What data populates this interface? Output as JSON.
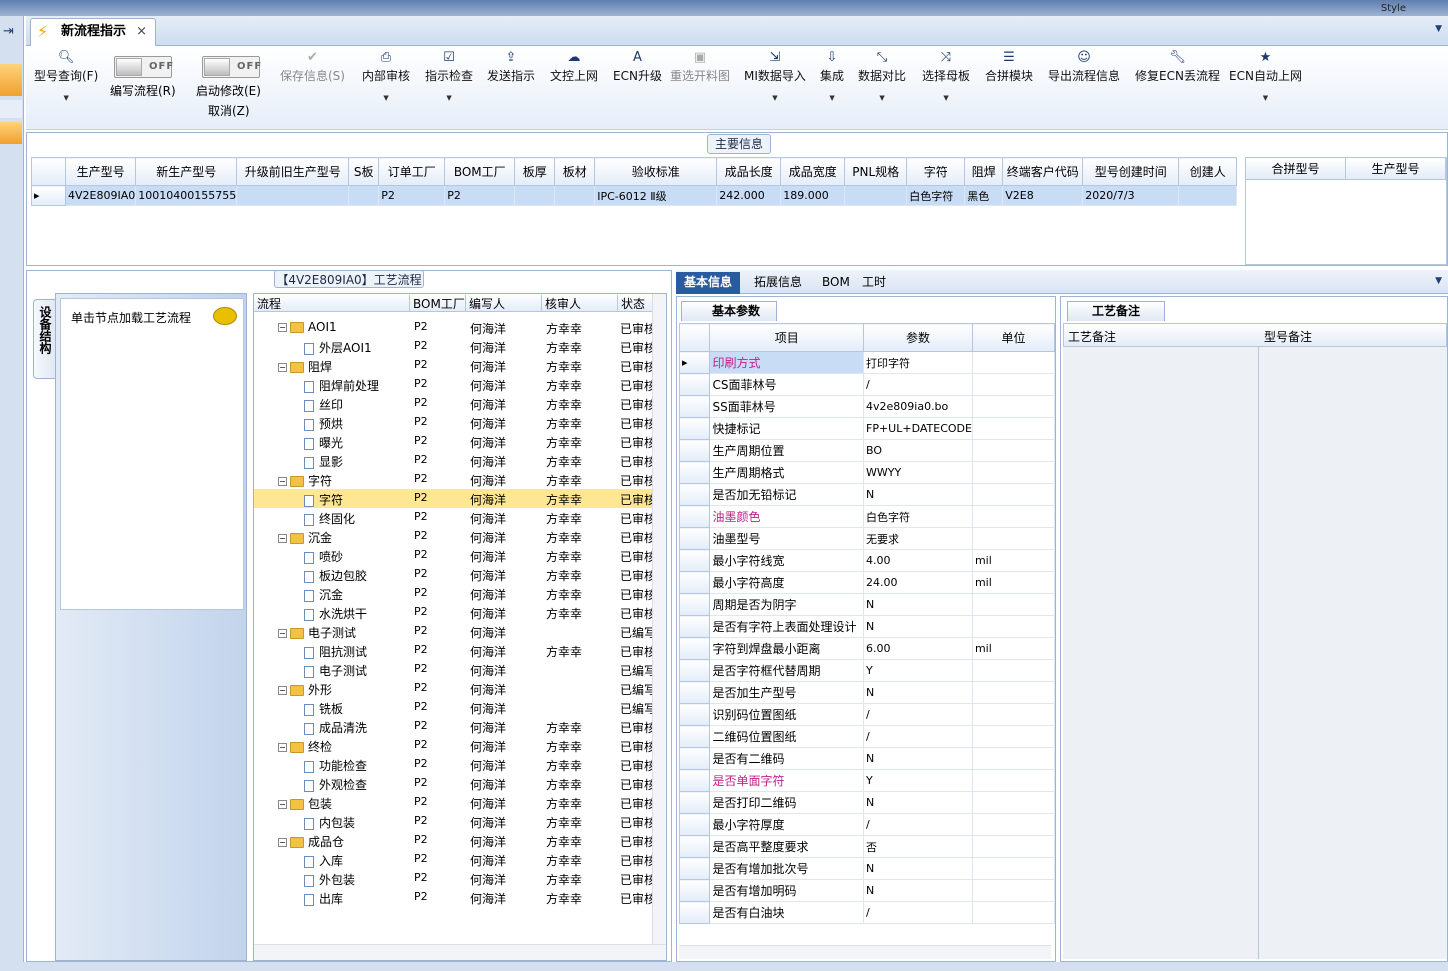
{
  "window": {
    "style_label": "Style"
  },
  "doc_tab": {
    "title": "新流程指示"
  },
  "toolbar": {
    "items": [
      {
        "label": "型号查询(F)",
        "icon": "search-icon"
      },
      {
        "label": "保存信息(S)",
        "icon": "check-icon"
      },
      {
        "label": "内部审核",
        "icon": "printer-icon"
      },
      {
        "label": "指示检查",
        "icon": "checkbox-icon"
      },
      {
        "label": "发送指示",
        "icon": "upload-icon"
      },
      {
        "label": "文控上网",
        "icon": "cloud-upload-icon"
      },
      {
        "label": "ECN升级",
        "icon": "font-icon"
      },
      {
        "label": "重选开料图",
        "icon": "image-icon"
      },
      {
        "label": "MI数据导入",
        "icon": "import-icon"
      },
      {
        "label": "集成",
        "icon": "download-icon"
      },
      {
        "label": "数据对比",
        "icon": "compress-icon"
      },
      {
        "label": "选择母板",
        "icon": "shuffle-icon"
      },
      {
        "label": "合拼模块",
        "icon": "list-icon"
      },
      {
        "label": "导出流程信息",
        "icon": "smile-icon"
      },
      {
        "label": "修复ECN丢流程",
        "icon": "wrench-icon"
      },
      {
        "label": "ECN自动上网",
        "icon": "star-icon"
      }
    ],
    "toggle_off": "OFF",
    "toggle1_label": "编写流程(R)",
    "toggle2_label": "启动修改(E)",
    "cancel_label": "取消(Z)"
  },
  "main_info": {
    "title": "主要信息",
    "columns": [
      "生产型号",
      "新生产型号",
      "升级前旧生产型号",
      "S板",
      "订单工厂",
      "BOM工厂",
      "板厚",
      "板材",
      "验收标准",
      "成品长度",
      "成品宽度",
      "PNL规格",
      "字符",
      "阻焊",
      "终端客户代码",
      "型号创建时间",
      "创建人"
    ],
    "row": [
      "4V2E809IA0",
      "10010400155755",
      "",
      "",
      "P2",
      "P2",
      "",
      "",
      "IPC-6012 Ⅱ级",
      "242.000",
      "189.000",
      "",
      "白色字符",
      "黑色",
      "V2E8",
      "2020/7/3",
      ""
    ],
    "side_columns": [
      "合拼型号",
      "生产型号"
    ]
  },
  "process": {
    "title": "【4V2E809IA0】工艺流程",
    "vtab": "设备结构",
    "load_hint": "单击节点加载工艺流程",
    "columns": [
      "流程",
      "BOM工厂",
      "编写人",
      "核审人",
      "状态"
    ],
    "rows": [
      {
        "lvl": 1,
        "name": "AOI1",
        "bom": "P2",
        "writer": "何海洋",
        "reviewer": "方幸幸",
        "status": "已审核"
      },
      {
        "lvl": 2,
        "name": "外层AOI1",
        "bom": "P2",
        "writer": "何海洋",
        "reviewer": "方幸幸",
        "status": "已审核"
      },
      {
        "lvl": 1,
        "name": "阻焊",
        "bom": "P2",
        "writer": "何海洋",
        "reviewer": "方幸幸",
        "status": "已审核"
      },
      {
        "lvl": 2,
        "name": "阻焊前处理",
        "bom": "P2",
        "writer": "何海洋",
        "reviewer": "方幸幸",
        "status": "已审核"
      },
      {
        "lvl": 2,
        "name": "丝印",
        "bom": "P2",
        "writer": "何海洋",
        "reviewer": "方幸幸",
        "status": "已审核"
      },
      {
        "lvl": 2,
        "name": "预烘",
        "bom": "P2",
        "writer": "何海洋",
        "reviewer": "方幸幸",
        "status": "已审核"
      },
      {
        "lvl": 2,
        "name": "曝光",
        "bom": "P2",
        "writer": "何海洋",
        "reviewer": "方幸幸",
        "status": "已审核"
      },
      {
        "lvl": 2,
        "name": "显影",
        "bom": "P2",
        "writer": "何海洋",
        "reviewer": "方幸幸",
        "status": "已审核"
      },
      {
        "lvl": 1,
        "name": "字符",
        "bom": "P2",
        "writer": "何海洋",
        "reviewer": "方幸幸",
        "status": "已审核"
      },
      {
        "lvl": 2,
        "name": "字符",
        "bom": "P2",
        "writer": "何海洋",
        "reviewer": "方幸幸",
        "status": "已审核",
        "hl": true
      },
      {
        "lvl": 2,
        "name": "终固化",
        "bom": "P2",
        "writer": "何海洋",
        "reviewer": "方幸幸",
        "status": "已审核"
      },
      {
        "lvl": 1,
        "name": "沉金",
        "bom": "P2",
        "writer": "何海洋",
        "reviewer": "方幸幸",
        "status": "已审核"
      },
      {
        "lvl": 2,
        "name": "喷砂",
        "bom": "P2",
        "writer": "何海洋",
        "reviewer": "方幸幸",
        "status": "已审核"
      },
      {
        "lvl": 2,
        "name": "板边包胶",
        "bom": "P2",
        "writer": "何海洋",
        "reviewer": "方幸幸",
        "status": "已审核"
      },
      {
        "lvl": 2,
        "name": "沉金",
        "bom": "P2",
        "writer": "何海洋",
        "reviewer": "方幸幸",
        "status": "已审核"
      },
      {
        "lvl": 2,
        "name": "水洗烘干",
        "bom": "P2",
        "writer": "何海洋",
        "reviewer": "方幸幸",
        "status": "已审核"
      },
      {
        "lvl": 1,
        "name": "电子测试",
        "bom": "P2",
        "writer": "何海洋",
        "reviewer": "",
        "status": "已编写"
      },
      {
        "lvl": 2,
        "name": "阻抗测试",
        "bom": "P2",
        "writer": "何海洋",
        "reviewer": "方幸幸",
        "status": "已审核"
      },
      {
        "lvl": 2,
        "name": "电子测试",
        "bom": "P2",
        "writer": "何海洋",
        "reviewer": "",
        "status": "已编写"
      },
      {
        "lvl": 1,
        "name": "外形",
        "bom": "P2",
        "writer": "何海洋",
        "reviewer": "",
        "status": "已编写"
      },
      {
        "lvl": 2,
        "name": "铣板",
        "bom": "P2",
        "writer": "何海洋",
        "reviewer": "",
        "status": "已编写"
      },
      {
        "lvl": 2,
        "name": "成品清洗",
        "bom": "P2",
        "writer": "何海洋",
        "reviewer": "方幸幸",
        "status": "已审核"
      },
      {
        "lvl": 1,
        "name": "终检",
        "bom": "P2",
        "writer": "何海洋",
        "reviewer": "方幸幸",
        "status": "已审核"
      },
      {
        "lvl": 2,
        "name": "功能检查",
        "bom": "P2",
        "writer": "何海洋",
        "reviewer": "方幸幸",
        "status": "已审核"
      },
      {
        "lvl": 2,
        "name": "外观检查",
        "bom": "P2",
        "writer": "何海洋",
        "reviewer": "方幸幸",
        "status": "已审核"
      },
      {
        "lvl": 1,
        "name": "包装",
        "bom": "P2",
        "writer": "何海洋",
        "reviewer": "方幸幸",
        "status": "已审核"
      },
      {
        "lvl": 2,
        "name": "内包装",
        "bom": "P2",
        "writer": "何海洋",
        "reviewer": "方幸幸",
        "status": "已审核"
      },
      {
        "lvl": 1,
        "name": "成品仓",
        "bom": "P2",
        "writer": "何海洋",
        "reviewer": "方幸幸",
        "status": "已审核"
      },
      {
        "lvl": 2,
        "name": "入库",
        "bom": "P2",
        "writer": "何海洋",
        "reviewer": "方幸幸",
        "status": "已审核"
      },
      {
        "lvl": 2,
        "name": "外包装",
        "bom": "P2",
        "writer": "何海洋",
        "reviewer": "方幸幸",
        "status": "已审核"
      },
      {
        "lvl": 2,
        "name": "出库",
        "bom": "P2",
        "writer": "何海洋",
        "reviewer": "方幸幸",
        "status": "已审核"
      }
    ]
  },
  "right_tabs": [
    "基本信息",
    "拓展信息",
    "BOM",
    "工时"
  ],
  "params": {
    "title": "基本参数",
    "columns": [
      "项目",
      "参数",
      "单位"
    ],
    "rows": [
      {
        "item": "印刷方式",
        "value": "打印字符",
        "unit": "",
        "mag": true
      },
      {
        "item": "CS面菲林号",
        "value": "/",
        "unit": ""
      },
      {
        "item": "SS面菲林号",
        "value": "4v2e809ia0.bo",
        "unit": ""
      },
      {
        "item": "快捷标记",
        "value": "FP+UL+DATECODE",
        "unit": ""
      },
      {
        "item": "生产周期位置",
        "value": "BO",
        "unit": ""
      },
      {
        "item": "生产周期格式",
        "value": "WWYY",
        "unit": ""
      },
      {
        "item": "是否加无铅标记",
        "value": "N",
        "unit": ""
      },
      {
        "item": "油墨颜色",
        "value": "白色字符",
        "unit": "",
        "mag": true
      },
      {
        "item": "油墨型号",
        "value": "无要求",
        "unit": ""
      },
      {
        "item": "最小字符线宽",
        "value": "4.00",
        "unit": "mil"
      },
      {
        "item": "最小字符高度",
        "value": "24.00",
        "unit": "mil"
      },
      {
        "item": "周期是否为阴字",
        "value": "N",
        "unit": ""
      },
      {
        "item": "是否有字符上表面处理设计",
        "value": "N",
        "unit": ""
      },
      {
        "item": "字符到焊盘最小距离",
        "value": "6.00",
        "unit": "mil"
      },
      {
        "item": "是否字符框代替周期",
        "value": "Y",
        "unit": ""
      },
      {
        "item": "是否加生产型号",
        "value": "N",
        "unit": ""
      },
      {
        "item": "识别码位置图纸",
        "value": "/",
        "unit": ""
      },
      {
        "item": "二维码位置图纸",
        "value": "/",
        "unit": ""
      },
      {
        "item": "是否有二维码",
        "value": "N",
        "unit": ""
      },
      {
        "item": "是否单面字符",
        "value": "Y",
        "unit": "",
        "mag": true
      },
      {
        "item": "是否打印二维码",
        "value": "N",
        "unit": ""
      },
      {
        "item": "最小字符厚度",
        "value": "/",
        "unit": ""
      },
      {
        "item": "是否高平整度要求",
        "value": "否",
        "unit": ""
      },
      {
        "item": "是否有增加批次号",
        "value": "N",
        "unit": ""
      },
      {
        "item": "是否有增加明码",
        "value": "N",
        "unit": ""
      },
      {
        "item": "是否有白油块",
        "value": "/",
        "unit": ""
      }
    ]
  },
  "notes": {
    "title": "工艺备注",
    "col1": "工艺备注",
    "col2": "型号备注"
  }
}
